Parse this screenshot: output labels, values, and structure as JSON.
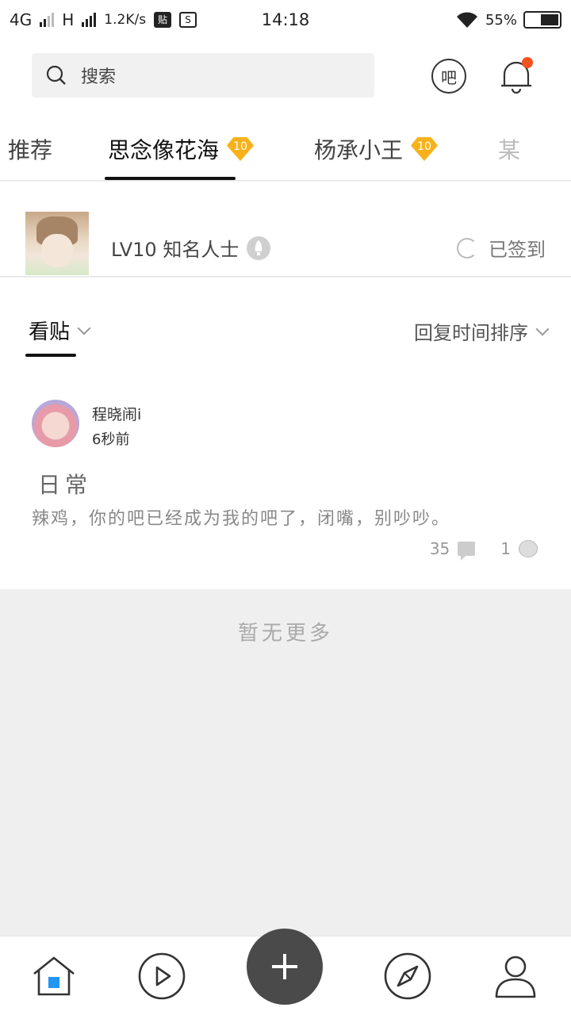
{
  "status_bar": {
    "network": "4G",
    "network2": "H",
    "speed": "1.2K/s",
    "tie_icon_text": "贴",
    "s_icon_text": "S",
    "time": "14:18",
    "battery": "55%"
  },
  "header": {
    "search_placeholder": "搜索",
    "ba_label": "吧",
    "notification_dot_color": "#f4511e"
  },
  "tabs": [
    {
      "label": "推荐",
      "badge": ""
    },
    {
      "label": "思念像花海",
      "badge": "10",
      "active": true
    },
    {
      "label": "杨承小王",
      "badge": "10"
    },
    {
      "label": "某"
    }
  ],
  "forum": {
    "level": "LV10 知名人士",
    "signed": "已签到"
  },
  "sort": {
    "left": "看贴",
    "right": "回复时间排序"
  },
  "post": {
    "user": "程晓闹i",
    "time": "6秒前",
    "title": "日常",
    "body": "辣鸡，你的吧已经成为我的吧了，闭嘴，别吵吵。",
    "comments": "35",
    "likes": "1"
  },
  "footer_text": "暂无更多",
  "bottom_nav": [
    "home-icon",
    "video-icon",
    "add-icon",
    "discover-icon",
    "profile-icon"
  ],
  "colors": {
    "accent": "#2196f3",
    "badge": "#f7b21b",
    "fab": "#4a4a4a"
  }
}
